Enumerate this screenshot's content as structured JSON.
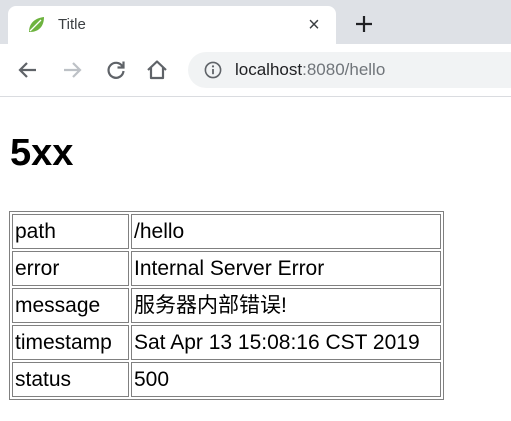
{
  "tab": {
    "title": "Title",
    "close_glyph": "×",
    "favicon": "leaf-icon",
    "favicon_color": "#6db33f"
  },
  "toolbar": {
    "back_icon": "arrow-left-icon",
    "forward_icon": "arrow-right-icon",
    "reload_icon": "reload-icon",
    "home_icon": "home-icon",
    "new_tab_icon": "plus-icon"
  },
  "address_bar": {
    "info_icon": "info-icon",
    "host": "localhost",
    "rest": ":8080/hello"
  },
  "page": {
    "heading": "5xx",
    "rows": [
      {
        "key": "path",
        "value": "/hello"
      },
      {
        "key": "error",
        "value": "Internal Server Error"
      },
      {
        "key": "message",
        "value": "服务器内部错误!"
      },
      {
        "key": "timestamp",
        "value": "Sat Apr 13 15:08:16 CST 2019"
      },
      {
        "key": "status",
        "value": "500"
      }
    ]
  },
  "colors": {
    "tabstrip": "#dee1e6",
    "omnibox": "#f1f3f4",
    "icon": "#5f6368",
    "table_border": "#808080"
  }
}
